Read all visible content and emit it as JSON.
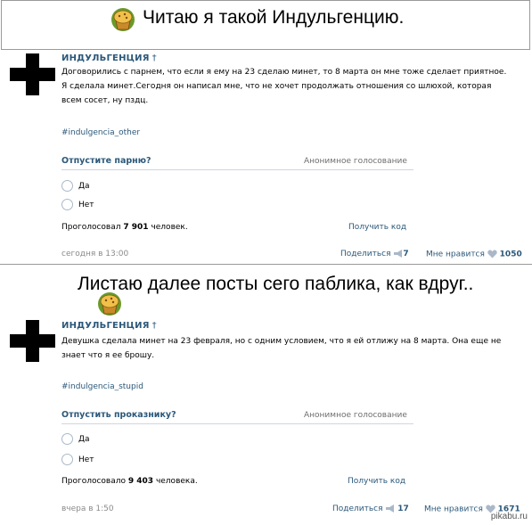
{
  "top_caption": "Читаю я такой Индульгенцию.",
  "middle_caption": "Листаю далее посты сего паблика, как вдруг..",
  "posts": [
    {
      "author": "ИНДУЛЬГЕНЦИЯ",
      "author_mark": "†",
      "text_lines": [
        "Договорились с парнем, что если я ему на 23 сделаю минет, то 8 марта он мне тоже сделает приятное.",
        "Я сделала минет.Сегодня он написал мне, что не хочет продолжать отношения со шлюхой, которая",
        "всем сосет, ну пздц."
      ],
      "hashtag": "#indulgencia_other",
      "poll_question": "Отпустите парню?",
      "poll_type": "Анонимное голосование",
      "options": [
        "Да",
        "Нет"
      ],
      "voted_prefix": "Проголосовал",
      "voted_count": "7 901",
      "voted_suffix": "человек.",
      "get_code": "Получить код",
      "time": "сегодня в 13:00",
      "share_label": "Поделиться",
      "share_count": "7",
      "like_label": "Мне нравится",
      "like_count": "1050"
    },
    {
      "author": "ИНДУЛЬГЕНЦИЯ",
      "author_mark": "†",
      "text_lines": [
        "Девушка сделала минет на 23 февраля, но с одним условием, что я ей отлижу на 8 марта. Она еще не",
        "знает что я ее брошу."
      ],
      "hashtag": "#indulgencia_stupid",
      "poll_question": "Отпустить проказнику?",
      "poll_type": "Анонимное голосование",
      "options": [
        "Да",
        "Нет"
      ],
      "voted_prefix": "Проголосовало",
      "voted_count": "9 403",
      "voted_suffix": "человека.",
      "get_code": "Получить код",
      "time": "вчера в 1:50",
      "share_label": "Поделиться",
      "share_count": "17",
      "like_label": "Мне нравится",
      "like_count": "1671"
    }
  ],
  "watermark": "pikabu.ru",
  "icons": [
    "muffin-icon",
    "black-cross-avatar",
    "radio-button",
    "megaphone-icon",
    "heart-icon"
  ],
  "colors": {
    "link": "#2b587a",
    "muted": "#8a8a8a",
    "border": "#9a9a9a"
  }
}
